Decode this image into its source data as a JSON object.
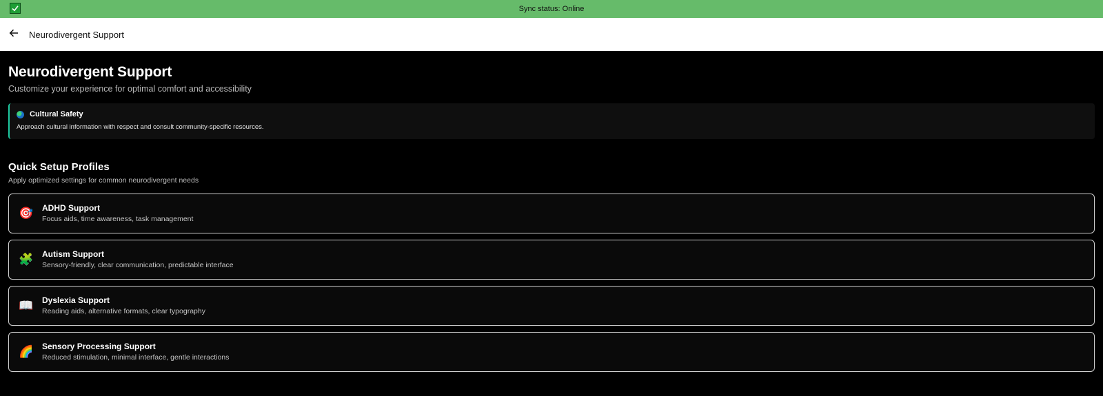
{
  "sync": {
    "status_text": "Sync status: Online",
    "icon": "checkmark-icon",
    "color": "#66bb6a"
  },
  "header": {
    "back_icon": "arrow-left-icon",
    "title": "Neurodivergent Support"
  },
  "page": {
    "title": "Neurodivergent Support",
    "subtitle": "Customize your experience for optimal comfort and accessibility"
  },
  "notice": {
    "icon": "globe-icon",
    "title": "Cultural Safety",
    "text": "Approach cultural information with respect and consult community-specific resources.",
    "accent_color": "#1ec9a0"
  },
  "profiles_section": {
    "title": "Quick Setup Profiles",
    "subtitle": "Apply optimized settings for common neurodivergent needs",
    "items": [
      {
        "icon": "target-icon",
        "glyph": "🎯",
        "title": "ADHD Support",
        "description": "Focus aids, time awareness, task management"
      },
      {
        "icon": "puzzle-icon",
        "glyph": "🧩",
        "title": "Autism Support",
        "description": "Sensory-friendly, clear communication, predictable interface"
      },
      {
        "icon": "book-icon",
        "glyph": "📖",
        "title": "Dyslexia Support",
        "description": "Reading aids, alternative formats, clear typography"
      },
      {
        "icon": "rainbow-icon",
        "glyph": "🌈",
        "title": "Sensory Processing Support",
        "description": "Reduced stimulation, minimal interface, gentle interactions"
      }
    ]
  }
}
